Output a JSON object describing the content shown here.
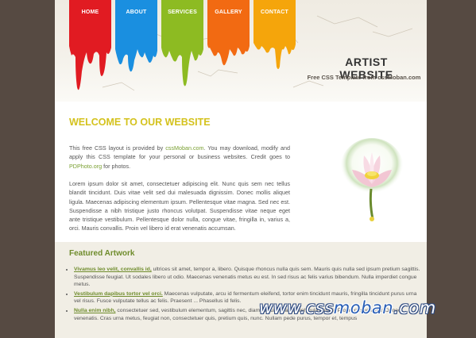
{
  "nav": [
    {
      "label": "HOME",
      "color": "#e11b22"
    },
    {
      "label": "ABOUT",
      "color": "#1a8fe0"
    },
    {
      "label": "SERVICES",
      "color": "#8dbb22"
    },
    {
      "label": "GALLERY",
      "color": "#f26a12"
    },
    {
      "label": "CONTACT",
      "color": "#f5a50b"
    }
  ],
  "header": {
    "title": "ARTIST WEBSITE",
    "subtitle": "Free CSS Template from cssMoban.com"
  },
  "main": {
    "heading": "WELCOME TO OUR WEBSITE",
    "intro": {
      "p1": "This free CSS layout is provided by ",
      "link1": "cssMoban.com",
      "p2": ". You may download, modify and apply this CSS template for your personal or business websites. Credit goes to ",
      "link2": "PDPhoto.org",
      "p3": " for photos."
    },
    "lorem": "Lorem ipsum dolor sit amet, consectetuer adipiscing elit. Nunc quis sem nec tellus blandit tincidunt. Duis vitae velit sed dui malesuada dignissim. Donec mollis aliquet ligula. Maecenas adipiscing elementum ipsum. Pellentesque vitae magna. Sed nec est. Suspendisse a nibh tristique justo rhoncus volutpat. Suspendisse vitae neque eget ante tristique vestibulum. Pellentesque dolor nulla, congue vitae, fringilla in, varius a, orci. Mauris convallis. Proin vel libero id erat venenatis accumsan."
  },
  "featured": {
    "title": "Featured Artwork",
    "items": [
      {
        "link": "Vivamus leo velit, convallis id,",
        "text": " ultrices sit amet, tempor a, libero. Quisque rhoncus nulla quis sem. Mauris quis nulla sed ipsum pretium sagittis. Suspendisse feugiat. Ut sodales libero ut odio. Maecenas venenatis metus eu est. In sed risus ac felis varius bibendum. Nulla imperdiet congue metus."
      },
      {
        "link": "Vestibulum dapibus tortor vel orci.",
        "text": " Maecenas vulputate, arcu id fermentum eleifend, tortor enim tincidunt mauris, fringilla tincidunt purus urna vel risus. Fusce vulputate tellus ac felis. Praesent ... Phasellus id felis."
      },
      {
        "link": "Nulla enim nibh,",
        "text": " consectetuer sed, vestibulum elementum, sagittis nec, diam. Mauris blandit vehicula neque. Proin consectetuer. Donec venenatis. Cras urna metus, feugiat non, consectetuer quis, pretium quis, nunc. Nullam pede purus, tempor et, tempus"
      }
    ]
  },
  "watermark": {
    "prefix": "www.css",
    "brand": "moban",
    "suffix": ".com"
  }
}
